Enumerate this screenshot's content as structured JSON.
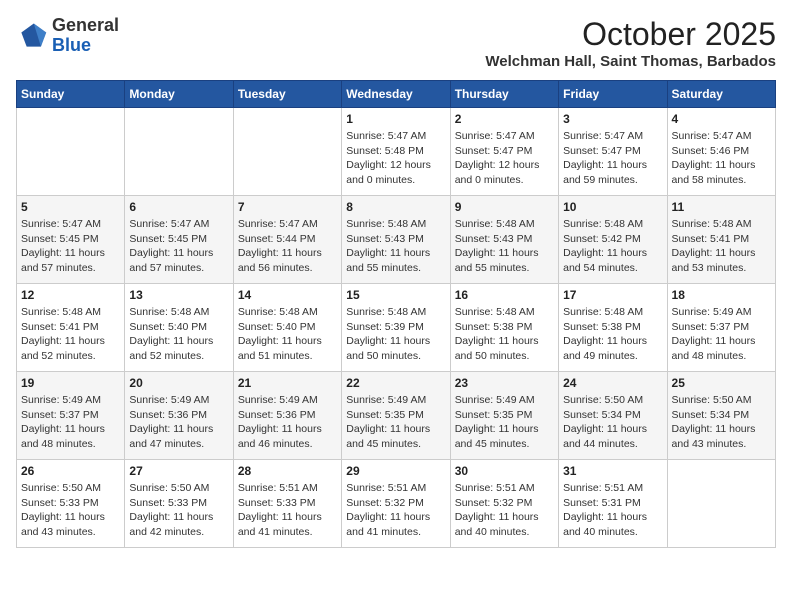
{
  "header": {
    "logo_general": "General",
    "logo_blue": "Blue",
    "month": "October 2025",
    "location": "Welchman Hall, Saint Thomas, Barbados"
  },
  "days_of_week": [
    "Sunday",
    "Monday",
    "Tuesday",
    "Wednesday",
    "Thursday",
    "Friday",
    "Saturday"
  ],
  "weeks": [
    [
      {
        "day": "",
        "sunrise": "",
        "sunset": "",
        "daylight": ""
      },
      {
        "day": "",
        "sunrise": "",
        "sunset": "",
        "daylight": ""
      },
      {
        "day": "",
        "sunrise": "",
        "sunset": "",
        "daylight": ""
      },
      {
        "day": "1",
        "sunrise": "Sunrise: 5:47 AM",
        "sunset": "Sunset: 5:48 PM",
        "daylight": "Daylight: 12 hours and 0 minutes."
      },
      {
        "day": "2",
        "sunrise": "Sunrise: 5:47 AM",
        "sunset": "Sunset: 5:47 PM",
        "daylight": "Daylight: 12 hours and 0 minutes."
      },
      {
        "day": "3",
        "sunrise": "Sunrise: 5:47 AM",
        "sunset": "Sunset: 5:47 PM",
        "daylight": "Daylight: 11 hours and 59 minutes."
      },
      {
        "day": "4",
        "sunrise": "Sunrise: 5:47 AM",
        "sunset": "Sunset: 5:46 PM",
        "daylight": "Daylight: 11 hours and 58 minutes."
      }
    ],
    [
      {
        "day": "5",
        "sunrise": "Sunrise: 5:47 AM",
        "sunset": "Sunset: 5:45 PM",
        "daylight": "Daylight: 11 hours and 57 minutes."
      },
      {
        "day": "6",
        "sunrise": "Sunrise: 5:47 AM",
        "sunset": "Sunset: 5:45 PM",
        "daylight": "Daylight: 11 hours and 57 minutes."
      },
      {
        "day": "7",
        "sunrise": "Sunrise: 5:47 AM",
        "sunset": "Sunset: 5:44 PM",
        "daylight": "Daylight: 11 hours and 56 minutes."
      },
      {
        "day": "8",
        "sunrise": "Sunrise: 5:48 AM",
        "sunset": "Sunset: 5:43 PM",
        "daylight": "Daylight: 11 hours and 55 minutes."
      },
      {
        "day": "9",
        "sunrise": "Sunrise: 5:48 AM",
        "sunset": "Sunset: 5:43 PM",
        "daylight": "Daylight: 11 hours and 55 minutes."
      },
      {
        "day": "10",
        "sunrise": "Sunrise: 5:48 AM",
        "sunset": "Sunset: 5:42 PM",
        "daylight": "Daylight: 11 hours and 54 minutes."
      },
      {
        "day": "11",
        "sunrise": "Sunrise: 5:48 AM",
        "sunset": "Sunset: 5:41 PM",
        "daylight": "Daylight: 11 hours and 53 minutes."
      }
    ],
    [
      {
        "day": "12",
        "sunrise": "Sunrise: 5:48 AM",
        "sunset": "Sunset: 5:41 PM",
        "daylight": "Daylight: 11 hours and 52 minutes."
      },
      {
        "day": "13",
        "sunrise": "Sunrise: 5:48 AM",
        "sunset": "Sunset: 5:40 PM",
        "daylight": "Daylight: 11 hours and 52 minutes."
      },
      {
        "day": "14",
        "sunrise": "Sunrise: 5:48 AM",
        "sunset": "Sunset: 5:40 PM",
        "daylight": "Daylight: 11 hours and 51 minutes."
      },
      {
        "day": "15",
        "sunrise": "Sunrise: 5:48 AM",
        "sunset": "Sunset: 5:39 PM",
        "daylight": "Daylight: 11 hours and 50 minutes."
      },
      {
        "day": "16",
        "sunrise": "Sunrise: 5:48 AM",
        "sunset": "Sunset: 5:38 PM",
        "daylight": "Daylight: 11 hours and 50 minutes."
      },
      {
        "day": "17",
        "sunrise": "Sunrise: 5:48 AM",
        "sunset": "Sunset: 5:38 PM",
        "daylight": "Daylight: 11 hours and 49 minutes."
      },
      {
        "day": "18",
        "sunrise": "Sunrise: 5:49 AM",
        "sunset": "Sunset: 5:37 PM",
        "daylight": "Daylight: 11 hours and 48 minutes."
      }
    ],
    [
      {
        "day": "19",
        "sunrise": "Sunrise: 5:49 AM",
        "sunset": "Sunset: 5:37 PM",
        "daylight": "Daylight: 11 hours and 48 minutes."
      },
      {
        "day": "20",
        "sunrise": "Sunrise: 5:49 AM",
        "sunset": "Sunset: 5:36 PM",
        "daylight": "Daylight: 11 hours and 47 minutes."
      },
      {
        "day": "21",
        "sunrise": "Sunrise: 5:49 AM",
        "sunset": "Sunset: 5:36 PM",
        "daylight": "Daylight: 11 hours and 46 minutes."
      },
      {
        "day": "22",
        "sunrise": "Sunrise: 5:49 AM",
        "sunset": "Sunset: 5:35 PM",
        "daylight": "Daylight: 11 hours and 45 minutes."
      },
      {
        "day": "23",
        "sunrise": "Sunrise: 5:49 AM",
        "sunset": "Sunset: 5:35 PM",
        "daylight": "Daylight: 11 hours and 45 minutes."
      },
      {
        "day": "24",
        "sunrise": "Sunrise: 5:50 AM",
        "sunset": "Sunset: 5:34 PM",
        "daylight": "Daylight: 11 hours and 44 minutes."
      },
      {
        "day": "25",
        "sunrise": "Sunrise: 5:50 AM",
        "sunset": "Sunset: 5:34 PM",
        "daylight": "Daylight: 11 hours and 43 minutes."
      }
    ],
    [
      {
        "day": "26",
        "sunrise": "Sunrise: 5:50 AM",
        "sunset": "Sunset: 5:33 PM",
        "daylight": "Daylight: 11 hours and 43 minutes."
      },
      {
        "day": "27",
        "sunrise": "Sunrise: 5:50 AM",
        "sunset": "Sunset: 5:33 PM",
        "daylight": "Daylight: 11 hours and 42 minutes."
      },
      {
        "day": "28",
        "sunrise": "Sunrise: 5:51 AM",
        "sunset": "Sunset: 5:33 PM",
        "daylight": "Daylight: 11 hours and 41 minutes."
      },
      {
        "day": "29",
        "sunrise": "Sunrise: 5:51 AM",
        "sunset": "Sunset: 5:32 PM",
        "daylight": "Daylight: 11 hours and 41 minutes."
      },
      {
        "day": "30",
        "sunrise": "Sunrise: 5:51 AM",
        "sunset": "Sunset: 5:32 PM",
        "daylight": "Daylight: 11 hours and 40 minutes."
      },
      {
        "day": "31",
        "sunrise": "Sunrise: 5:51 AM",
        "sunset": "Sunset: 5:31 PM",
        "daylight": "Daylight: 11 hours and 40 minutes."
      },
      {
        "day": "",
        "sunrise": "",
        "sunset": "",
        "daylight": ""
      }
    ]
  ]
}
